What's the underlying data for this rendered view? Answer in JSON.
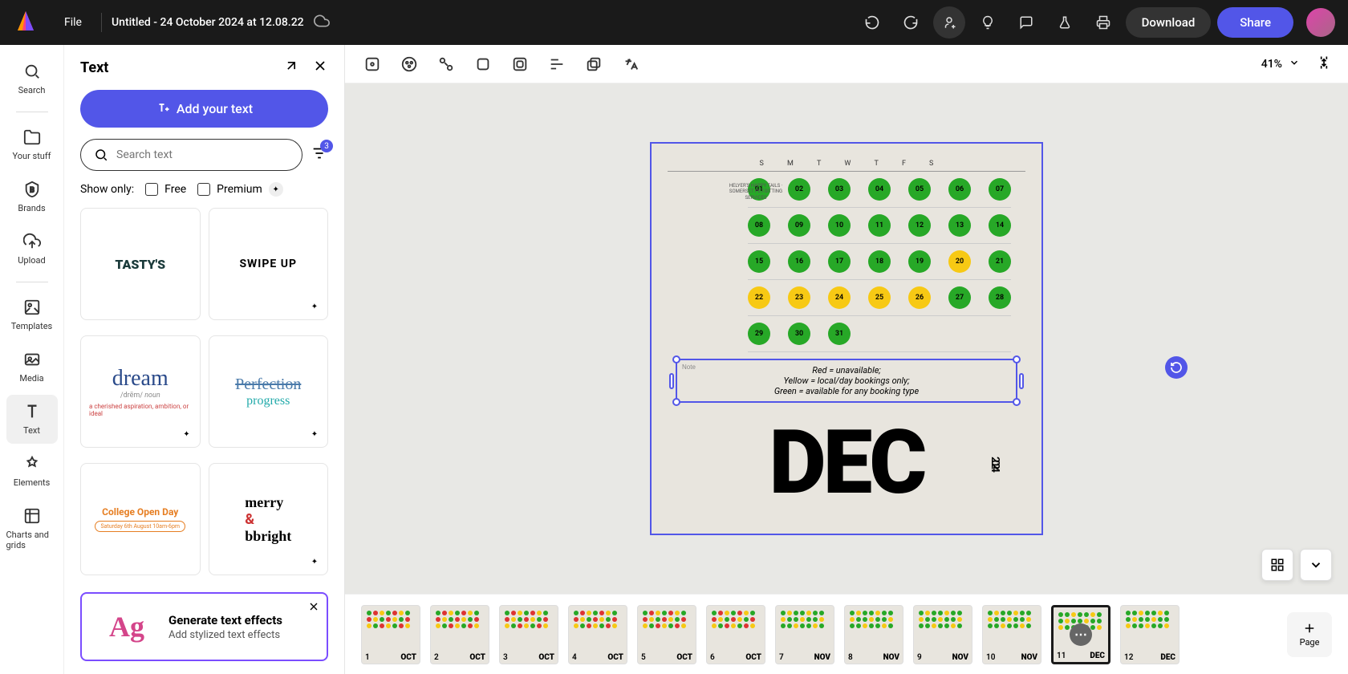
{
  "header": {
    "file_menu": "File",
    "doc_title": "Untitled - 24 October 2024 at 12.08.22",
    "download": "Download",
    "share": "Share"
  },
  "nav": {
    "search": "Search",
    "your_stuff": "Your stuff",
    "brands": "Brands",
    "upload": "Upload",
    "templates": "Templates",
    "media": "Media",
    "text": "Text",
    "elements": "Elements",
    "charts": "Charts and grids"
  },
  "panel": {
    "title": "Text",
    "add_text": "Add your text",
    "search_placeholder": "Search text",
    "filter_count": "3",
    "show_only": "Show only:",
    "free": "Free",
    "premium": "Premium",
    "gen_title": "Generate text effects",
    "gen_sub": "Add stylized text effects",
    "gen_icon": "Ag"
  },
  "templates": [
    {
      "label": "TASTY'S"
    },
    {
      "label": "SWIPE UP"
    },
    {
      "label": "dream"
    },
    {
      "label": "Perfection"
    },
    {
      "label": "College Open Day"
    },
    {
      "label": "merry & bright"
    }
  ],
  "canvas": {
    "zoom": "41%",
    "calendar": {
      "days_header": [
        "S",
        "M",
        "T",
        "W",
        "T",
        "F",
        "S"
      ],
      "logo_text": "HELYER'S HAPPY TAILS · SOMERSET PET-SITTING SERVICES",
      "rows": [
        [
          {
            "n": "01",
            "c": "green"
          },
          {
            "n": "02",
            "c": "green"
          },
          {
            "n": "03",
            "c": "green"
          },
          {
            "n": "04",
            "c": "green"
          },
          {
            "n": "05",
            "c": "green"
          },
          {
            "n": "06",
            "c": "green"
          },
          {
            "n": "07",
            "c": "green"
          }
        ],
        [
          {
            "n": "08",
            "c": "green"
          },
          {
            "n": "09",
            "c": "green"
          },
          {
            "n": "10",
            "c": "green"
          },
          {
            "n": "11",
            "c": "green"
          },
          {
            "n": "12",
            "c": "green"
          },
          {
            "n": "13",
            "c": "green"
          },
          {
            "n": "14",
            "c": "green"
          }
        ],
        [
          {
            "n": "15",
            "c": "green"
          },
          {
            "n": "16",
            "c": "green"
          },
          {
            "n": "17",
            "c": "green"
          },
          {
            "n": "18",
            "c": "green"
          },
          {
            "n": "19",
            "c": "green"
          },
          {
            "n": "20",
            "c": "yellow"
          },
          {
            "n": "21",
            "c": "green"
          }
        ],
        [
          {
            "n": "22",
            "c": "yellow"
          },
          {
            "n": "23",
            "c": "yellow"
          },
          {
            "n": "24",
            "c": "yellow"
          },
          {
            "n": "25",
            "c": "yellow"
          },
          {
            "n": "26",
            "c": "yellow"
          },
          {
            "n": "27",
            "c": "green"
          },
          {
            "n": "28",
            "c": "green"
          }
        ],
        [
          {
            "n": "29",
            "c": "green"
          },
          {
            "n": "30",
            "c": "green"
          },
          {
            "n": "31",
            "c": "green"
          },
          {
            "n": "",
            "c": "empty"
          },
          {
            "n": "",
            "c": "empty"
          },
          {
            "n": "",
            "c": "empty"
          },
          {
            "n": "",
            "c": "empty"
          }
        ]
      ],
      "note_label": "Note",
      "note_line1": "Red = unavailable;",
      "note_line2": "Yellow = local/day bookings only;",
      "note_line3": "Green = available for any booking type",
      "month": "DEC",
      "year": "2024"
    }
  },
  "thumbnails": [
    {
      "num": "1",
      "month": "OCT",
      "colors": [
        "#27a827",
        "#d33",
        "#f7c914"
      ]
    },
    {
      "num": "2",
      "month": "OCT",
      "colors": [
        "#27a827",
        "#d33",
        "#f7c914"
      ]
    },
    {
      "num": "3",
      "month": "OCT",
      "colors": [
        "#27a827",
        "#d33",
        "#f7c914"
      ]
    },
    {
      "num": "4",
      "month": "OCT",
      "colors": [
        "#27a827",
        "#d33",
        "#f7c914"
      ]
    },
    {
      "num": "5",
      "month": "OCT",
      "colors": [
        "#27a827",
        "#d33",
        "#f7c914"
      ]
    },
    {
      "num": "6",
      "month": "OCT",
      "colors": [
        "#27a827",
        "#d33",
        "#f7c914"
      ]
    },
    {
      "num": "7",
      "month": "NOV",
      "colors": [
        "#27a827",
        "#f7c914",
        "#27a827"
      ]
    },
    {
      "num": "8",
      "month": "NOV",
      "colors": [
        "#27a827",
        "#f7c914",
        "#27a827"
      ]
    },
    {
      "num": "9",
      "month": "NOV",
      "colors": [
        "#27a827",
        "#f7c914",
        "#27a827"
      ]
    },
    {
      "num": "10",
      "month": "NOV",
      "colors": [
        "#27a827",
        "#f7c914",
        "#27a827"
      ]
    },
    {
      "num": "11",
      "month": "DEC",
      "colors": [
        "#27a827",
        "#27a827",
        "#f7c914"
      ],
      "active": true
    },
    {
      "num": "12",
      "month": "DEC",
      "colors": [
        "#27a827",
        "#27a827",
        "#f7c914"
      ]
    }
  ],
  "add_page": "Page"
}
